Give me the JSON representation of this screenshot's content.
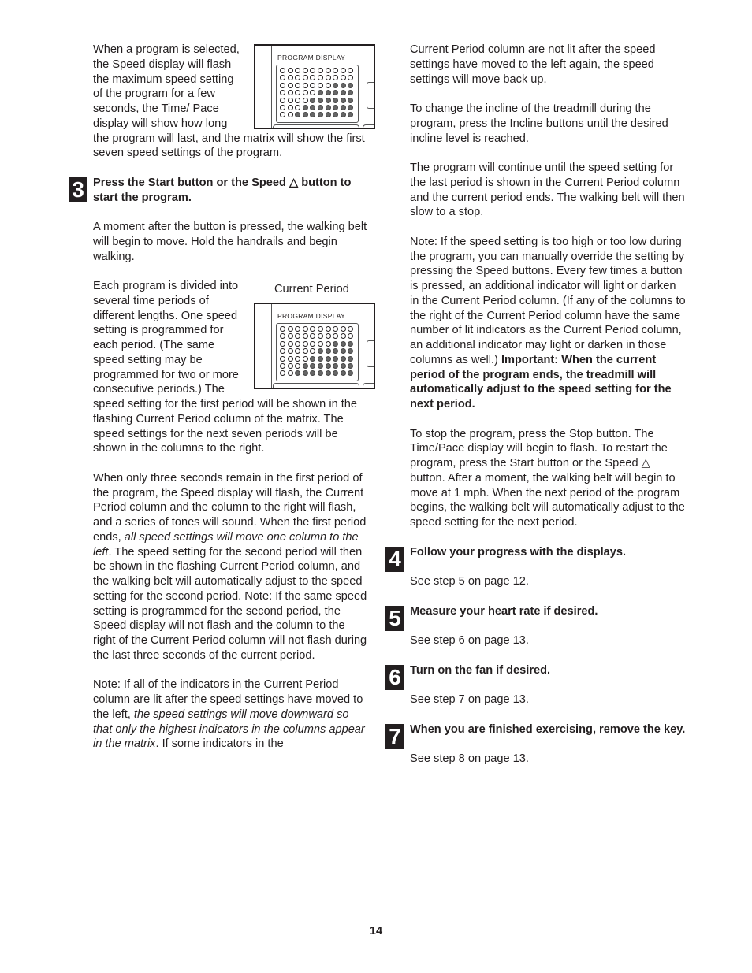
{
  "figures": {
    "program_display_label": "PROGRAM DISPLAY",
    "current_period_label": "Current Period",
    "matrix_lit_counts": [
      0,
      0,
      1,
      2,
      3,
      4,
      4,
      5,
      5,
      5
    ],
    "matrix_rows": 7
  },
  "left": {
    "intro": "When a program is selected, the Speed display will flash the maximum speed setting of the program for a few seconds, the Time/ Pace display will show how long the program will last, and the matrix will show the first seven speed settings of the program.",
    "step3": {
      "number": "3",
      "heading": "Press the Start button or the Speed △ button to start the program.",
      "p1": "A moment after the button is pressed, the walking belt will begin to move. Hold the handrails and begin walking.",
      "p2": "Each program is divided into several time periods of different lengths. One speed setting is programmed for each period. (The same speed setting may be programmed for two or more consecutive periods.) The speed setting for the first period will be shown in the flashing Current Period column of the matrix. The speed settings for the next seven periods will be shown in the columns to the right.",
      "p3_a": "When only three seconds remain in the first period of the program, the Speed display will flash, the Current Period column and the column to the right will flash, and a series of tones will sound. When the first period ends, ",
      "p3_italic": "all speed settings will move one column to the left",
      "p3_b": ". The speed setting for the second period will then be shown in the flashing Current Period column, and the walking belt will automatically adjust to the speed setting for the second period. Note: If the same speed setting is programmed for the second period, the Speed display will not flash and the column to the right of the Current Period column will not flash during the last three seconds of the current period.",
      "p4_a": "Note: If all of the indicators in the Current Period column are lit after the speed settings have moved to the left, ",
      "p4_italic": "the speed settings will move downward so that only the highest indicators in the columns appear in the matrix",
      "p4_b": ". If some indicators in the"
    }
  },
  "right": {
    "p1": "Current Period column are not lit after the speed settings have moved to the left again, the speed settings will move back up.",
    "p2": "To change the incline of the treadmill during the program, press the Incline buttons until the desired incline level is reached.",
    "p3": "The program will continue until the speed setting for the last period is shown in the Current Period column and the current period ends. The walking belt will then slow to a stop.",
    "p4_a": "Note: If the speed setting is too high or too low during the program, you can manually override the setting by pressing the Speed buttons. Every few times a button is pressed, an additional indicator will light or darken in the Current Period column. (If any of the columns to the right of the Current Period column have the same number of lit indicators as the Current Period column, an additional indicator may light or darken in those columns as well.) ",
    "p4_bold": "Important: When the current period of the program ends, the treadmill will automatically adjust to the speed setting for the next period.",
    "p5": "To stop the program, press the Stop button. The Time/Pace display will begin to flash. To restart the program, press the Start button or the Speed △ button. After a moment, the walking belt will begin to move at 1 mph. When the next period of the program begins, the walking belt will automatically adjust to the speed setting for the next period.",
    "steps": [
      {
        "number": "4",
        "heading": "Follow your progress with the displays.",
        "text": "See step 5 on page 12."
      },
      {
        "number": "5",
        "heading": "Measure your heart rate if desired.",
        "text": "See step 6 on page 13."
      },
      {
        "number": "6",
        "heading": "Turn on the fan if desired.",
        "text": "See step 7 on page 13."
      },
      {
        "number": "7",
        "heading": "When you are finished exercising, remove the key.",
        "text": "See step 8 on page 13."
      }
    ]
  },
  "page_number": "14"
}
